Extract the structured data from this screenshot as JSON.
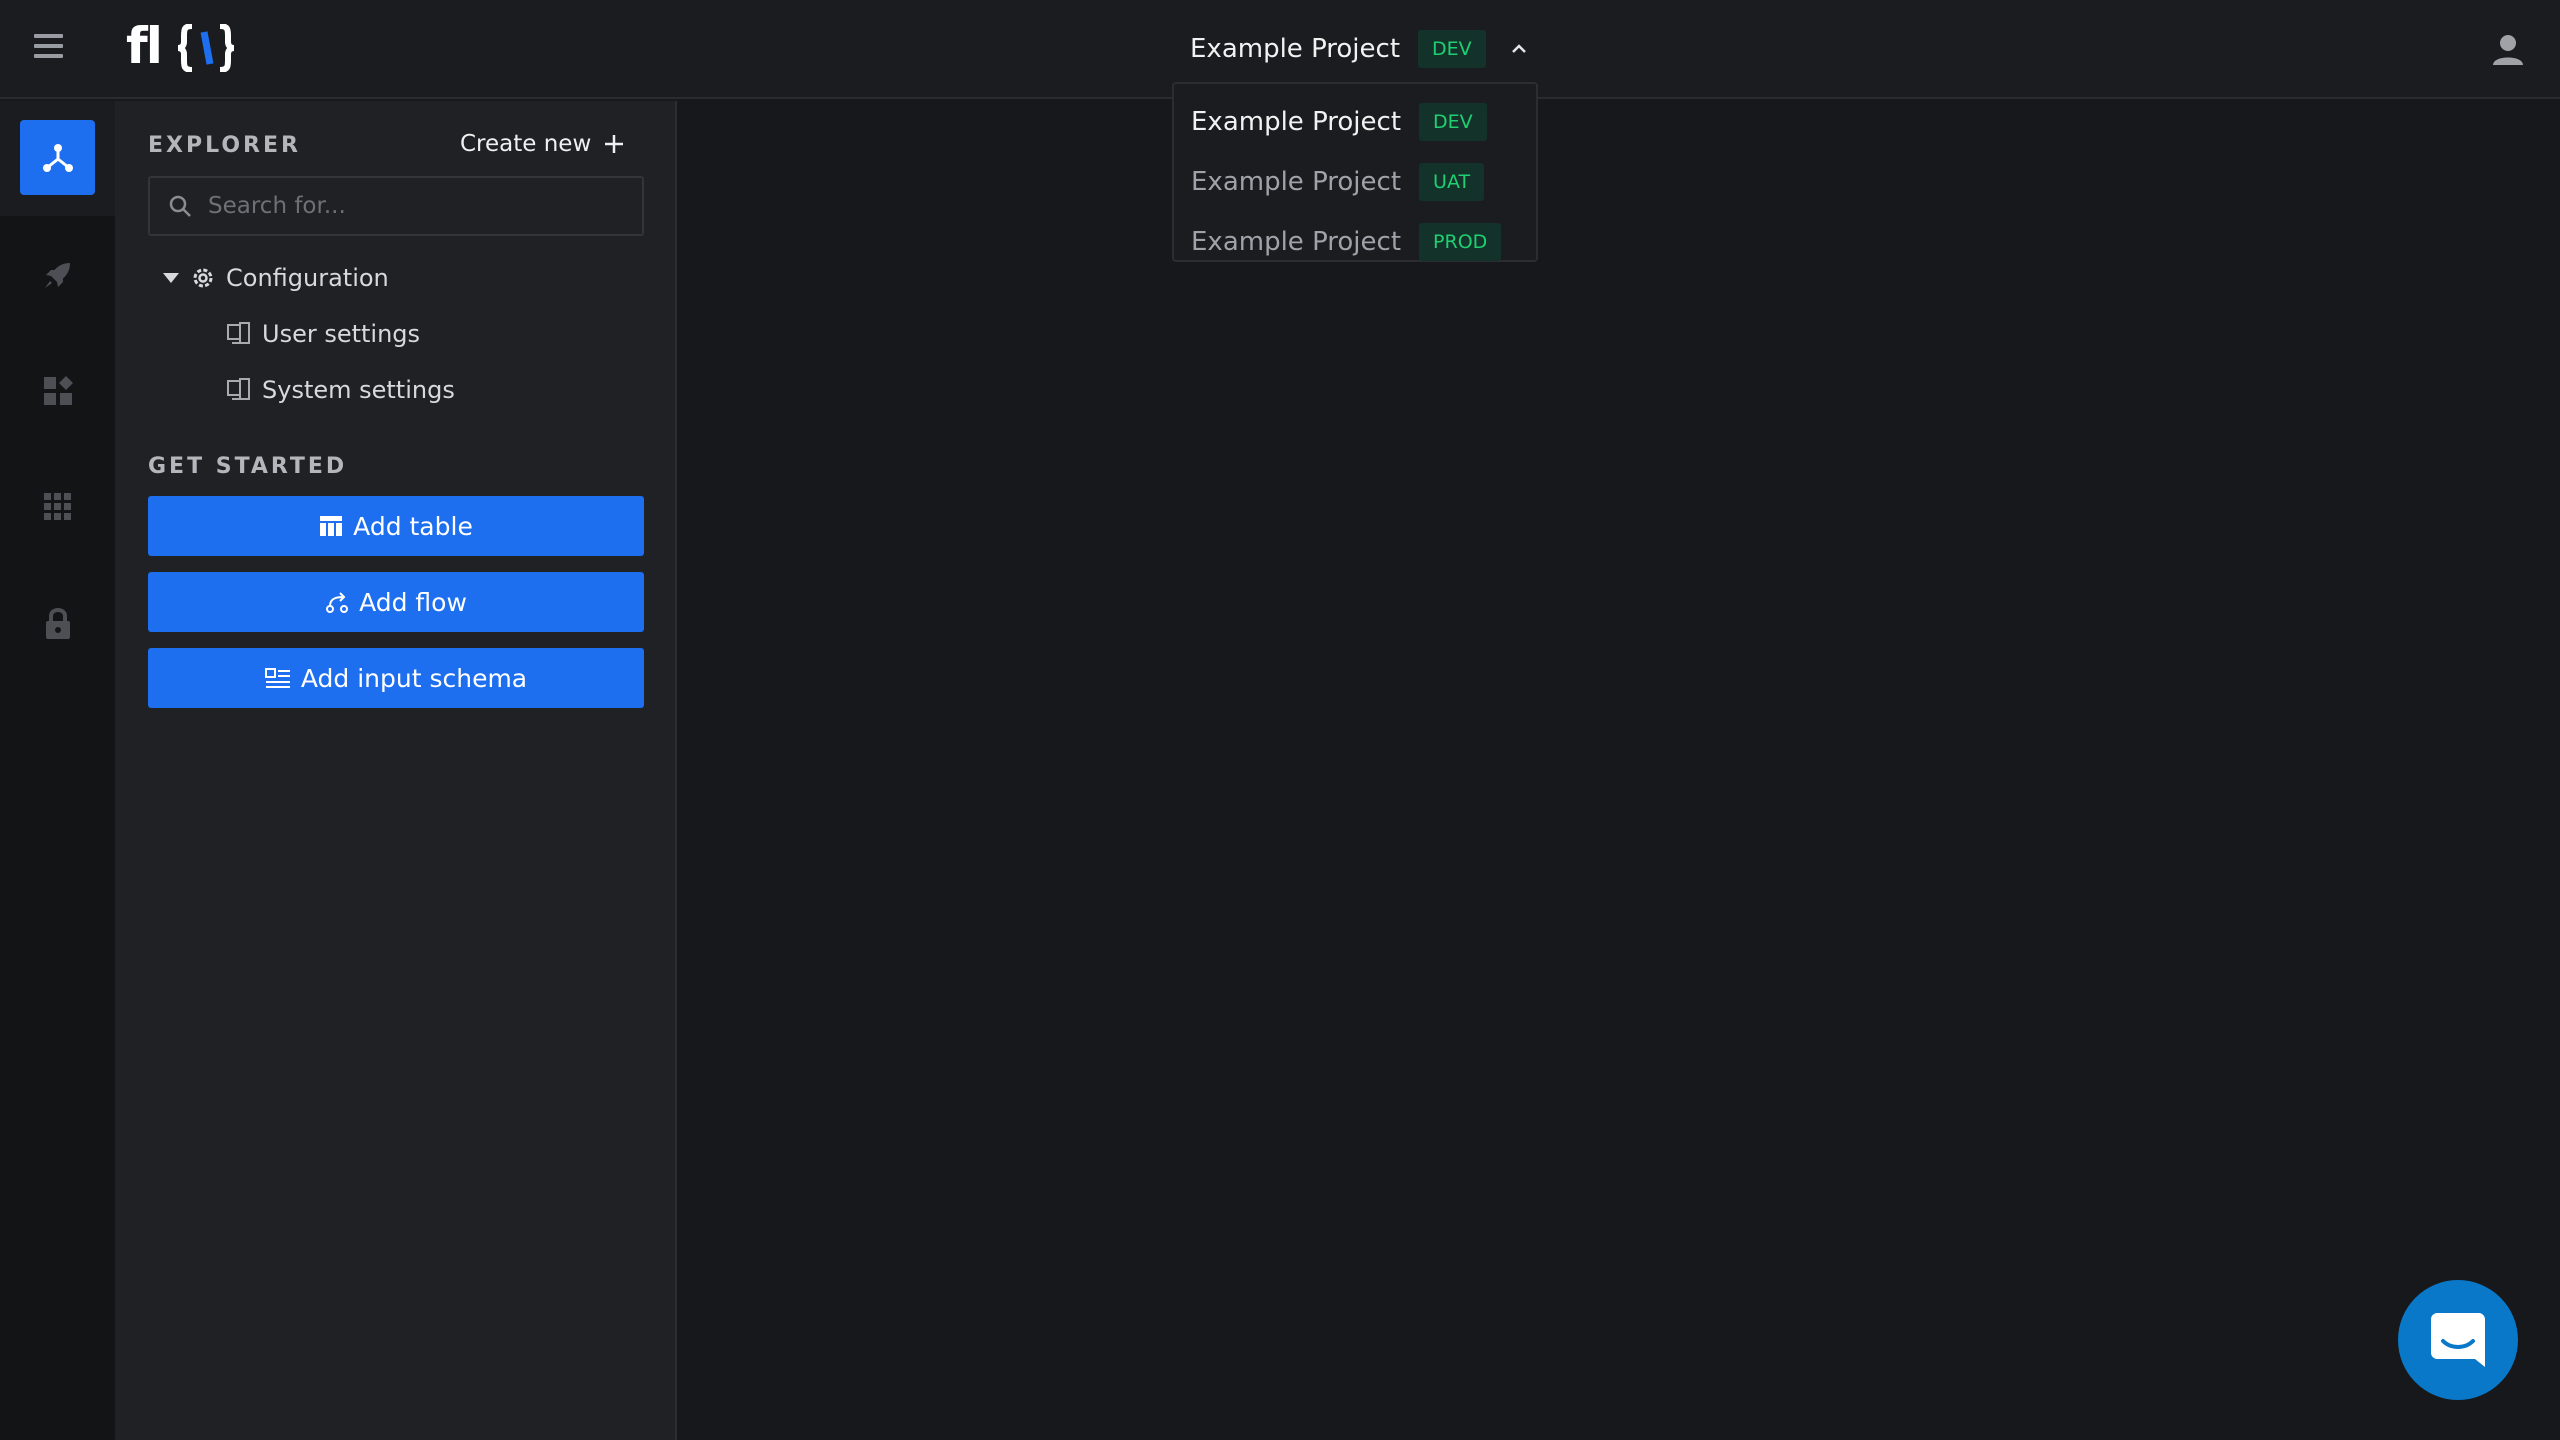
{
  "header": {
    "logo_text": "fl{/}",
    "project": {
      "name": "Example Project",
      "env": "DEV"
    }
  },
  "project_menu": {
    "items": [
      {
        "name": "Example Project",
        "env": "DEV"
      },
      {
        "name": "Example Project",
        "env": "UAT"
      },
      {
        "name": "Example Project",
        "env": "PROD"
      }
    ]
  },
  "rail": {
    "items": [
      "explorer-icon",
      "rocket-icon",
      "widgets-icon",
      "apps-grid-icon",
      "lock-icon"
    ]
  },
  "explorer": {
    "title": "EXPLORER",
    "create_new": "Create new",
    "search_placeholder": "Search for...",
    "tree": {
      "folder": "Configuration",
      "children": [
        "User settings",
        "System settings"
      ]
    }
  },
  "get_started": {
    "title": "GET STARTED",
    "buttons": [
      "Add table",
      "Add flow",
      "Add input schema"
    ]
  },
  "colors": {
    "accent": "#1e6ff0",
    "env_badge_text": "#1fcf72",
    "env_badge_bg": "#13322a",
    "background": "#17181b",
    "panel": "#202125",
    "chat": "#0a78c8"
  }
}
